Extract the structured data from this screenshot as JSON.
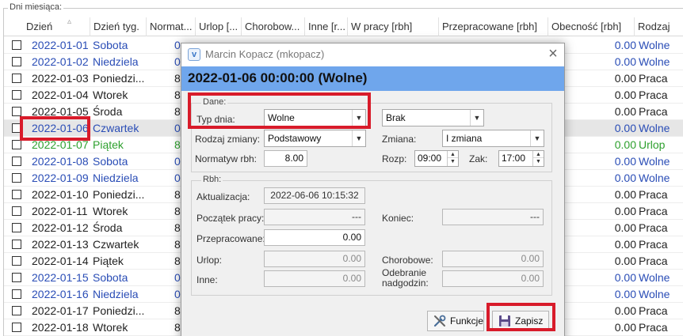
{
  "group_label": "Dni miesiąca:",
  "columns": [
    "Dzień",
    "Dzień tyg.",
    "Normat...",
    "Urlop [...",
    "Chorobow...",
    "Inne [r...",
    "W pracy [rbh]",
    "Przepracowane [rbh]",
    "Obecność [rbh]",
    "Rodzaj"
  ],
  "rows": [
    {
      "date": "2022-01-01",
      "weekday": "Sobota",
      "norm": "0",
      "presence": "0.00",
      "type": "Wolne",
      "color": "blue"
    },
    {
      "date": "2022-01-02",
      "weekday": "Niedziela",
      "norm": "0",
      "presence": "0.00",
      "type": "Wolne",
      "color": "blue"
    },
    {
      "date": "2022-01-03",
      "weekday": "Poniedzi...",
      "norm": "8",
      "presence": "0.00",
      "type": "Praca",
      "color": "dark"
    },
    {
      "date": "2022-01-04",
      "weekday": "Wtorek",
      "norm": "8",
      "presence": "0.00",
      "type": "Praca",
      "color": "dark"
    },
    {
      "date": "2022-01-05",
      "weekday": "Środa",
      "norm": "8",
      "presence": "0.00",
      "type": "Praca",
      "color": "dark"
    },
    {
      "date": "2022-01-06",
      "weekday": "Czwartek",
      "norm": "0",
      "presence": "0.00",
      "type": "Wolne",
      "color": "blue"
    },
    {
      "date": "2022-01-07",
      "weekday": "Piątek",
      "norm": "8",
      "presence": "0.00",
      "type": "Urlop",
      "color": "green"
    },
    {
      "date": "2022-01-08",
      "weekday": "Sobota",
      "norm": "0",
      "presence": "0.00",
      "type": "Wolne",
      "color": "blue"
    },
    {
      "date": "2022-01-09",
      "weekday": "Niedziela",
      "norm": "0",
      "presence": "0.00",
      "type": "Wolne",
      "color": "blue"
    },
    {
      "date": "2022-01-10",
      "weekday": "Poniedzi...",
      "norm": "8",
      "presence": "0.00",
      "type": "Praca",
      "color": "dark"
    },
    {
      "date": "2022-01-11",
      "weekday": "Wtorek",
      "norm": "8",
      "presence": "0.00",
      "type": "Praca",
      "color": "dark"
    },
    {
      "date": "2022-01-12",
      "weekday": "Środa",
      "norm": "8",
      "presence": "0.00",
      "type": "Praca",
      "color": "dark"
    },
    {
      "date": "2022-01-13",
      "weekday": "Czwartek",
      "norm": "8",
      "presence": "0.00",
      "type": "Praca",
      "color": "dark"
    },
    {
      "date": "2022-01-14",
      "weekday": "Piątek",
      "norm": "8",
      "presence": "0.00",
      "type": "Praca",
      "color": "dark"
    },
    {
      "date": "2022-01-15",
      "weekday": "Sobota",
      "norm": "0",
      "presence": "0.00",
      "type": "Wolne",
      "color": "blue"
    },
    {
      "date": "2022-01-16",
      "weekday": "Niedziela",
      "norm": "0",
      "presence": "0.00",
      "type": "Wolne",
      "color": "blue"
    },
    {
      "date": "2022-01-17",
      "weekday": "Poniedzi...",
      "norm": "8",
      "presence": "0.00",
      "type": "Praca",
      "color": "dark"
    },
    {
      "date": "2022-01-18",
      "weekday": "Wtorek",
      "norm": "8",
      "presence": "0.00",
      "type": "Praca",
      "color": "dark"
    }
  ],
  "dialog": {
    "title": "Marcin Kopacz (mkopacz)",
    "banner": "2022-01-06 00:00:00 (Wolne)",
    "dane": {
      "legend": "Dane:",
      "typ_dnia_label": "Typ dnia:",
      "typ_dnia_value": "Wolne",
      "brak_value": "Brak",
      "rodzaj_zmiany_label": "Rodzaj zmiany:",
      "rodzaj_zmiany_value": "Podstawowy",
      "zmiana_label": "Zmiana:",
      "zmiana_value": "I zmiana",
      "normatyw_label": "Normatyw rbh:",
      "normatyw_value": "8.00",
      "rozp_label": "Rozp:",
      "rozp_value": "09:00",
      "zak_label": "Zak:",
      "zak_value": "17:00"
    },
    "rbh": {
      "legend": "Rbh:",
      "aktualizacja_label": "Aktualizacja:",
      "aktualizacja_value": "2022-06-06 10:15:32",
      "poczatek_label": "Początek pracy:",
      "poczatek_value": "---",
      "koniec_label": "Koniec:",
      "koniec_value": "---",
      "przepracowane_label": "Przepracowane:",
      "przepracowane_value": "0.00",
      "urlop_label": "Urlop:",
      "urlop_value": "0.00",
      "chorobowe_label": "Chorobowe:",
      "chorobowe_value": "0.00",
      "inne_label": "Inne:",
      "inne_value": "0.00",
      "odebranie_label_1": "Odebranie",
      "odebranie_label_2": "nadgodzin:",
      "odebranie_value": "0.00"
    },
    "funkcje_label": "Funkcje",
    "zapisz_label": "Zapisz"
  },
  "colors": {
    "blue": "#2a4db6",
    "green": "#2ea02e",
    "highlight": "#d81b2a",
    "banner": "#6fa6ec"
  }
}
